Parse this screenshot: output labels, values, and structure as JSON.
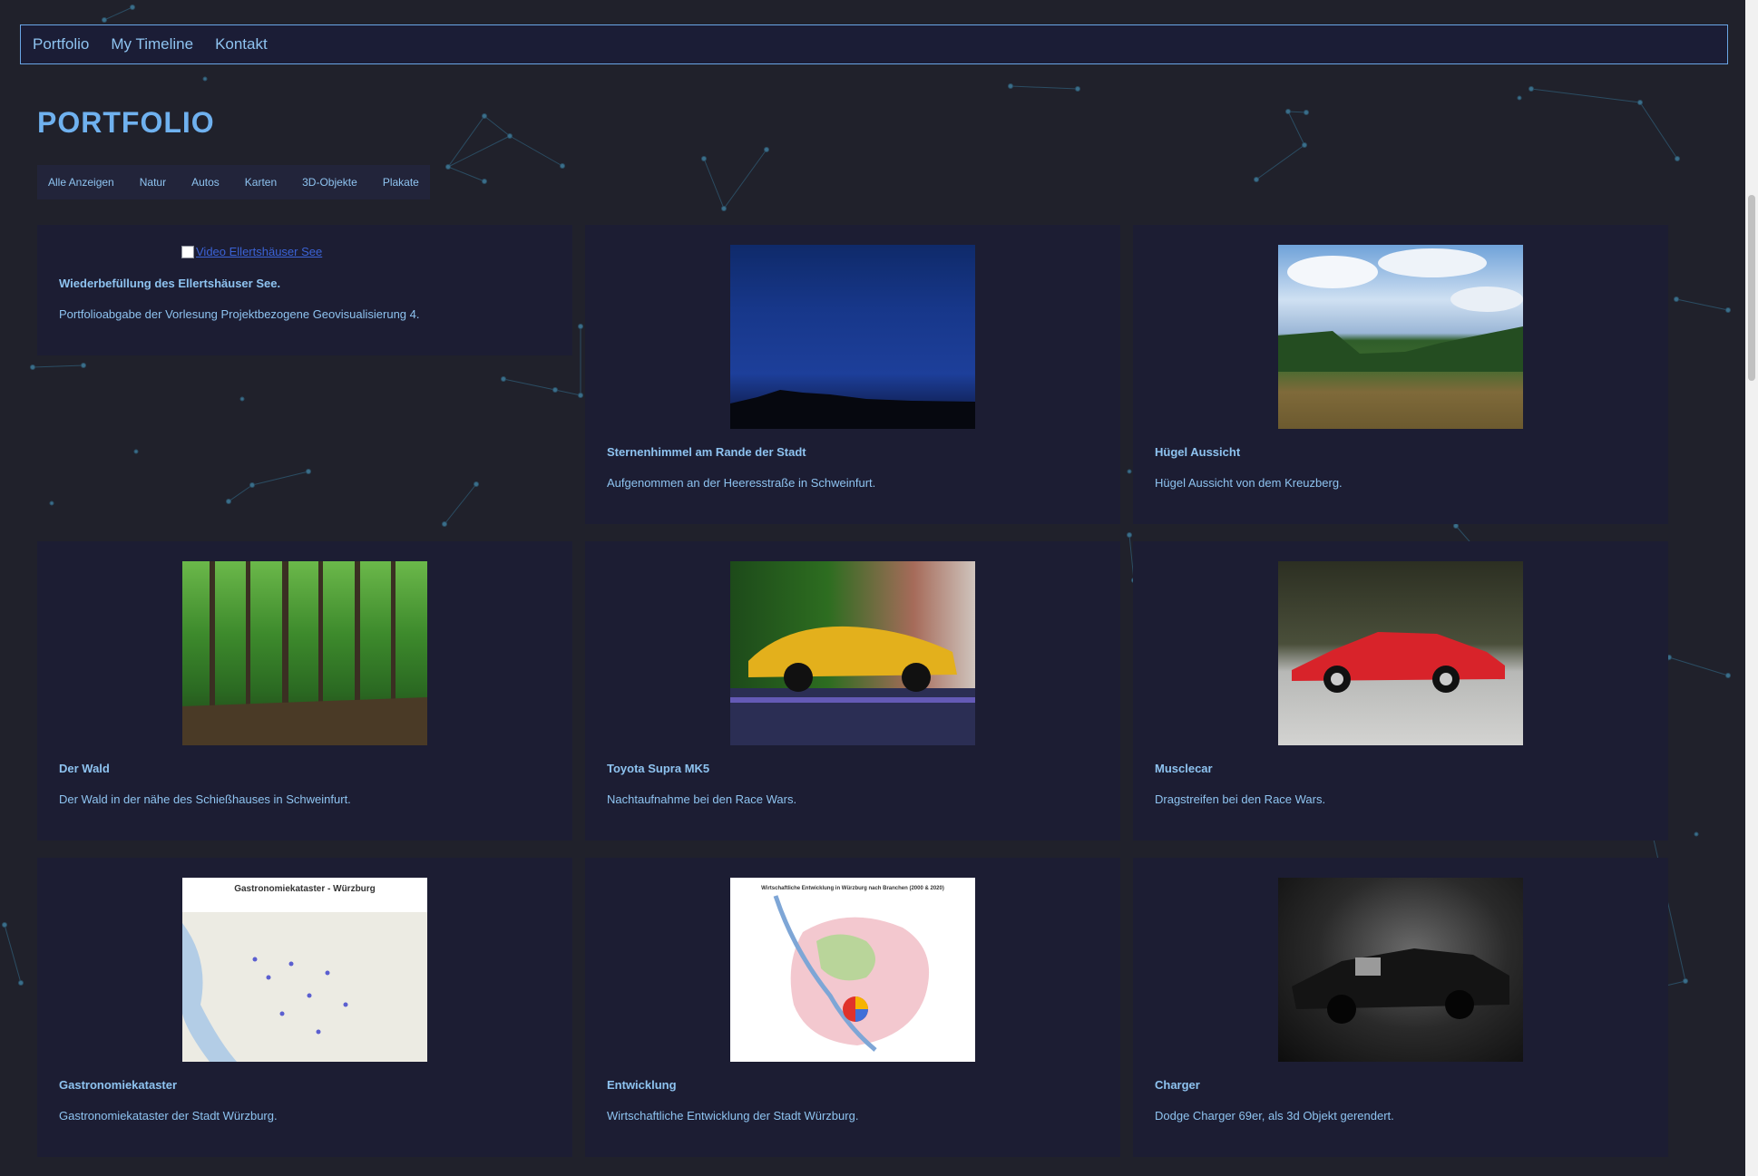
{
  "nav": {
    "items": [
      "Portfolio",
      "My Timeline",
      "Kontakt"
    ]
  },
  "page_title": "PORTFOLIO",
  "filters": [
    "Alle Anzeigen",
    "Natur",
    "Autos",
    "Karten",
    "3D-Objekte",
    "Plakate"
  ],
  "cards": [
    {
      "title": "Wiederbefüllung des Ellertshäuser See.",
      "desc": "Portfolioabgabe der Vorlesung Projektbezogene Geovisualisierung 4.",
      "img_alt": "Video Ellertshäuser See",
      "image": "broken"
    },
    {
      "title": "Sternenhimmel am Rande der Stadt",
      "desc": "Aufgenommen an der Heeresstraße in Schweinfurt.",
      "image": "night-sky"
    },
    {
      "title": "Hügel Aussicht",
      "desc": "Hügel Aussicht von dem Kreuzberg.",
      "image": "meadow"
    },
    {
      "title": "Der Wald",
      "desc": "Der Wald in der nähe des Schießhauses in Schweinfurt.",
      "image": "forest"
    },
    {
      "title": "Toyota Supra MK5",
      "desc": "Nachtaufnahme bei den Race Wars.",
      "image": "supra"
    },
    {
      "title": "Musclecar",
      "desc": "Dragstreifen bei den Race Wars.",
      "image": "red-car"
    },
    {
      "title": "Gastronomiekataster",
      "desc": "Gastronomiekataster der Stadt Würzburg.",
      "image": "map-gastro",
      "map_title": "Gastronomiekataster - Würzburg"
    },
    {
      "title": "Entwicklung",
      "desc": "Wirtschaftliche Entwicklung der Stadt Würzburg.",
      "image": "map-development",
      "map_title": "Wirtschaftliche Entwicklung in Würzburg nach Branchen (2000 & 2020)"
    },
    {
      "title": "Charger",
      "desc": "Dodge Charger 69er, als 3d Objekt gerendert.",
      "image": "charger"
    }
  ],
  "colors": {
    "background": "#20212b",
    "card": "#1c1d33",
    "accent": "#8ec3f0",
    "nav_border": "#6aa6e6"
  }
}
